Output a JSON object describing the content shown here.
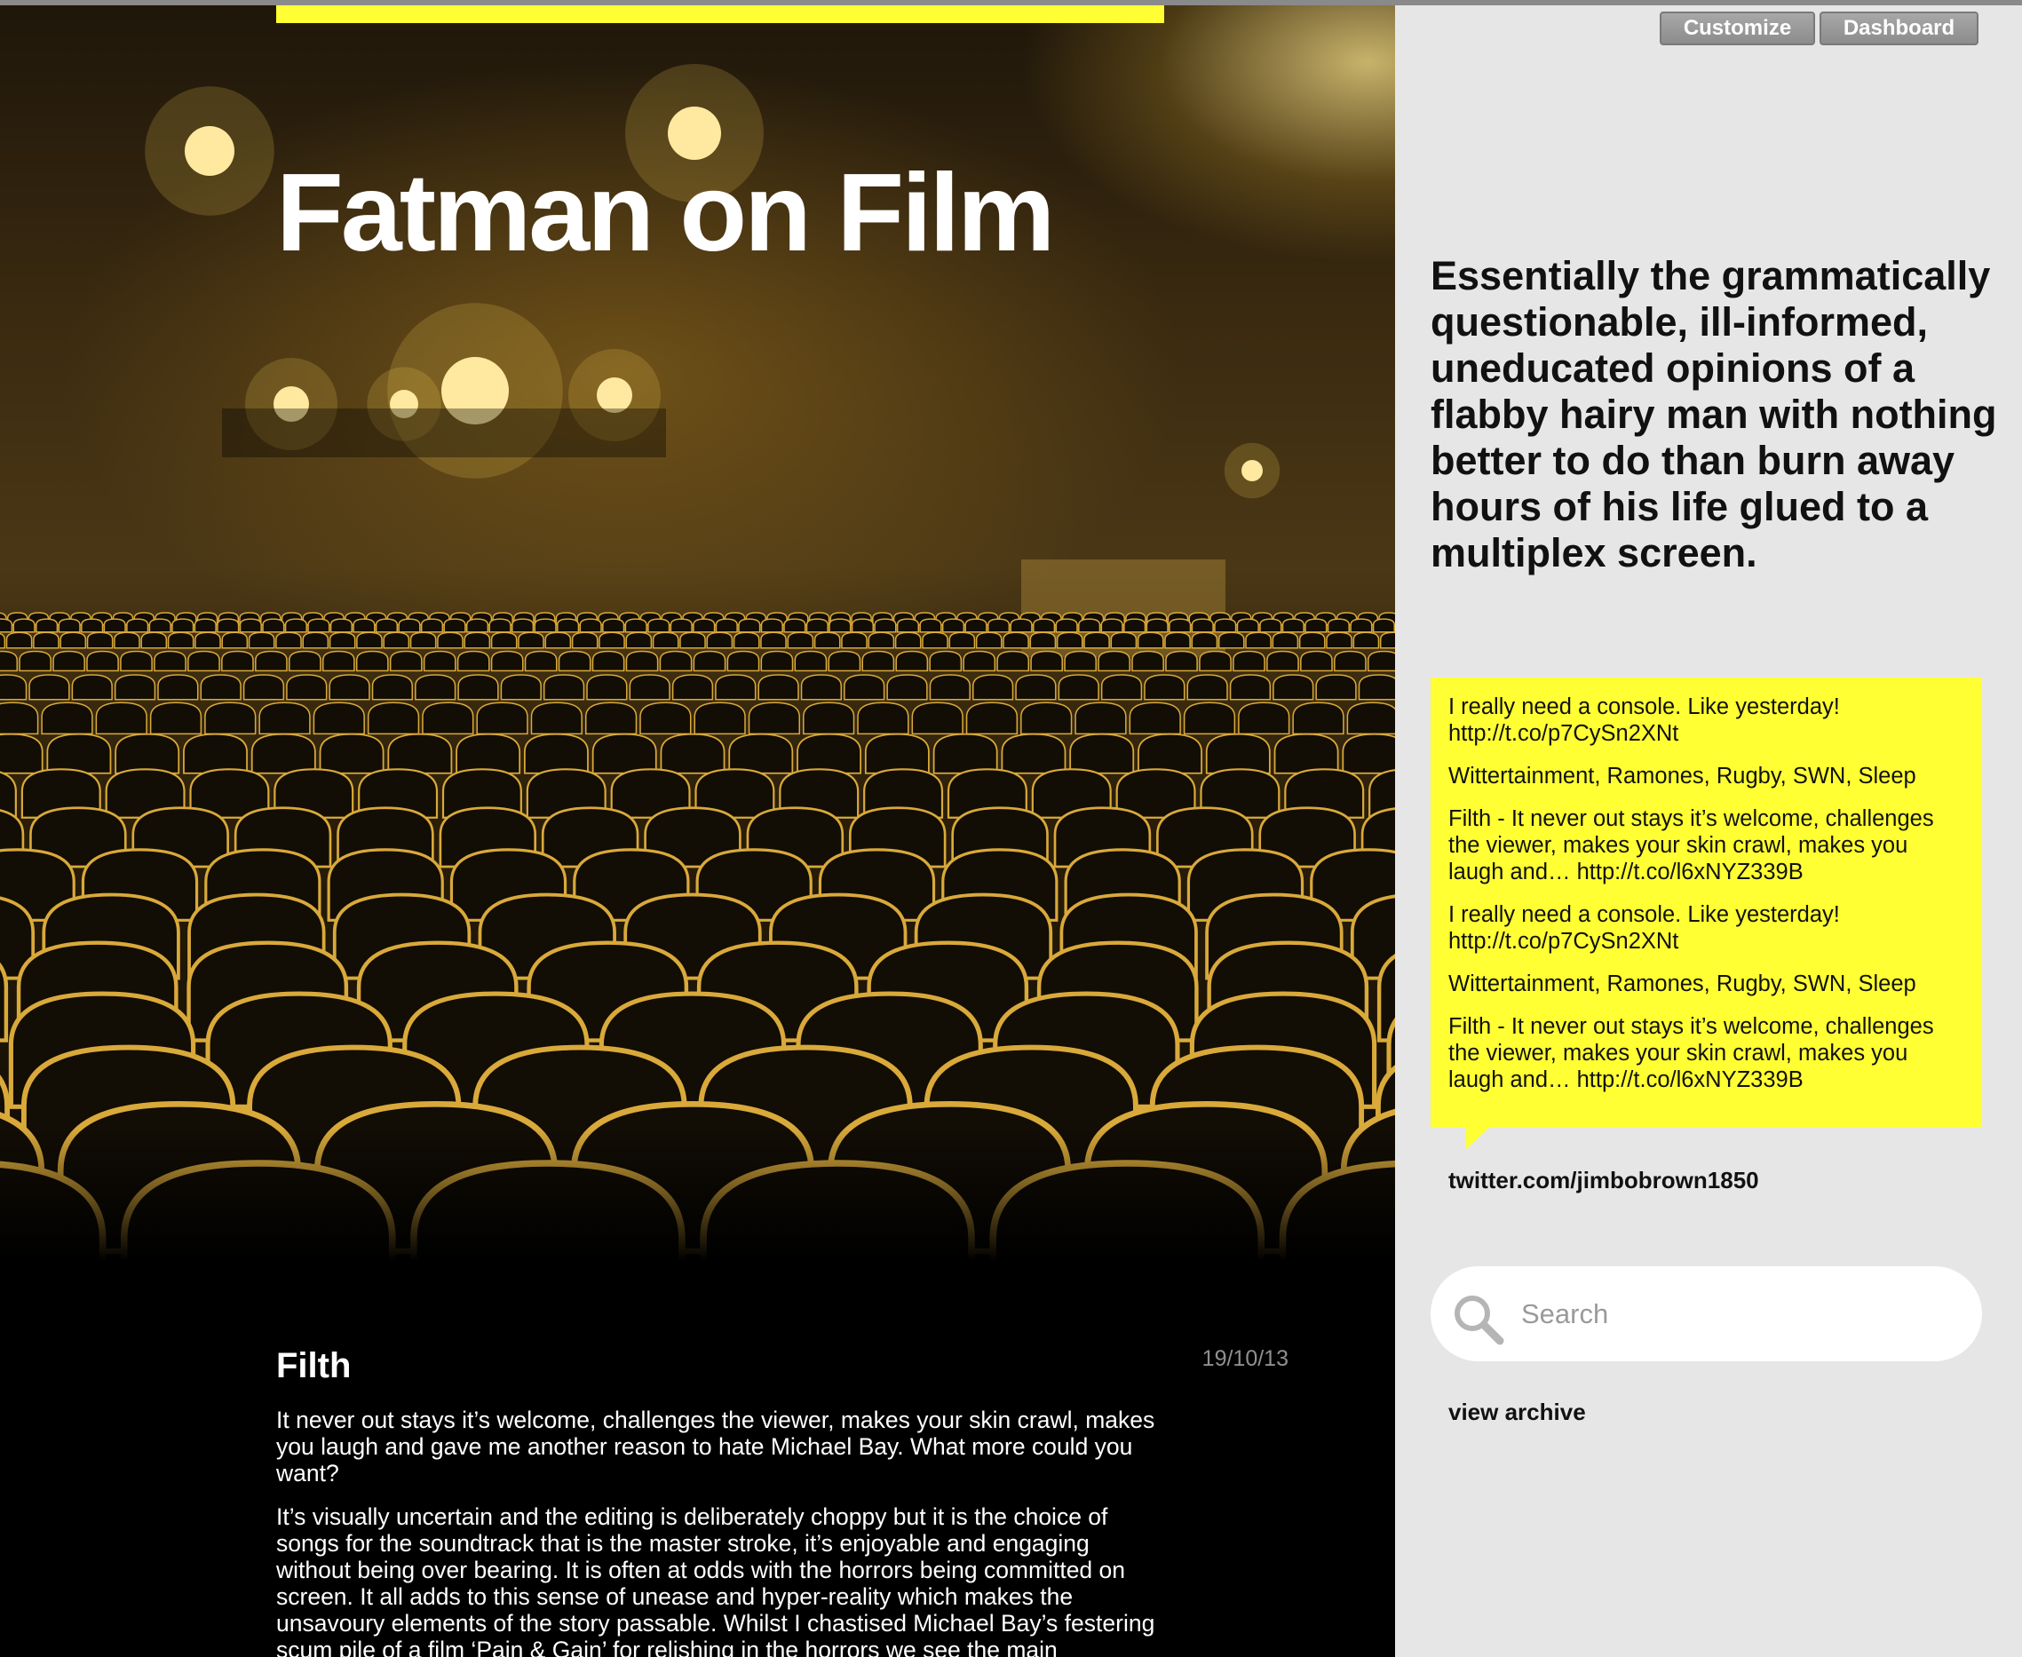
{
  "site": {
    "title": "Fatman on Film",
    "description": "Essentially the grammatically questionable, ill-informed, uneducated opinions of a flabby hairy man with nothing better to do than burn away hours of his life glued to a multiplex screen."
  },
  "admin": {
    "customize_label": "Customize",
    "dashboard_label": "Dashboard"
  },
  "post": {
    "title": "Filth",
    "date": "19/10/13",
    "paragraphs": [
      "It never out stays it’s welcome, challenges the viewer, makes your skin crawl, makes you laugh and gave me another reason to hate Michael Bay. What more could you want?",
      "It’s visually uncertain and the editing is deliberately choppy but it is the choice of songs for the soundtrack that is the master stroke, it’s enjoyable and engaging without being over bearing. It is often at odds with the horrors being committed on screen. It all adds to this sense of unease and hyper-reality which makes the unsavoury elements of the story passable. Whilst I chastised Michael Bay’s festering scum pile of a film ‘Pain & Gain’ for relishing in the horrors we see the main"
    ]
  },
  "twitter": {
    "tweets": [
      "I really need a console. Like yesterday! http://t.co/p7CySn2XNt",
      "Wittertainment, Ramones, Rugby, SWN, Sleep",
      "Filth - It never out stays it’s welcome, challenges the viewer, makes your skin crawl, makes you laugh and… http://t.co/l6xNYZ339B",
      "I really need a console. Like yesterday! http://t.co/p7CySn2XNt",
      "Wittertainment, Ramones, Rugby, SWN, Sleep",
      "Filth - It never out stays it’s welcome, challenges the viewer, makes your skin crawl, makes you laugh and… http://t.co/l6xNYZ339B"
    ],
    "profile_link": "twitter.com/jimbobrown1850"
  },
  "search": {
    "placeholder": "Search",
    "icon": "search-icon"
  },
  "archive": {
    "label": "view archive"
  },
  "colors": {
    "accent": "#ffff33",
    "sidebar_bg": "#e6e6e6",
    "main_bg": "#000000"
  }
}
